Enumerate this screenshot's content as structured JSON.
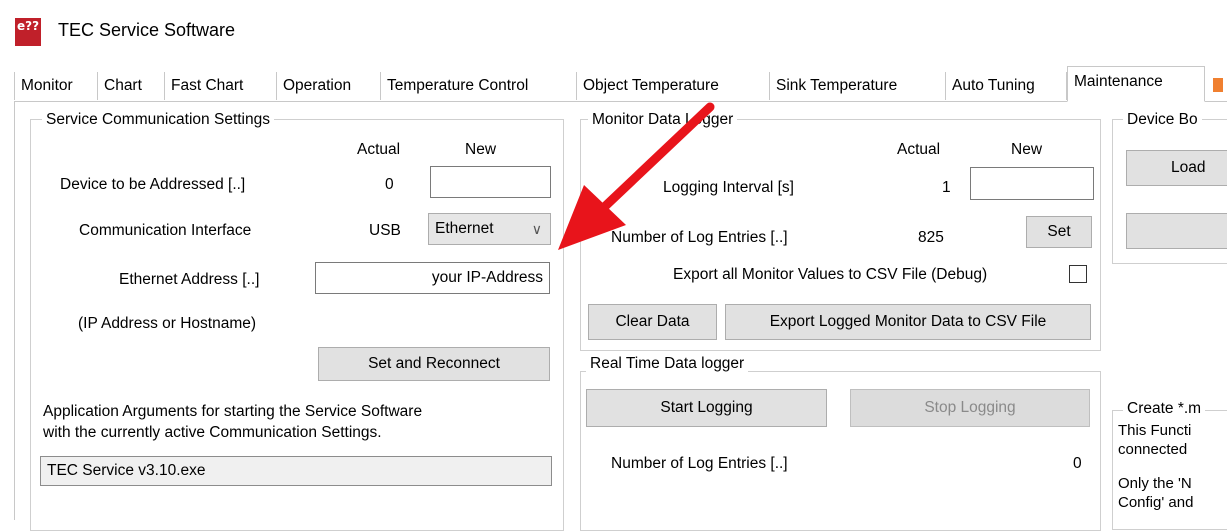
{
  "window": {
    "title": "TEC Service Software",
    "icon_text": "e??"
  },
  "tabs": [
    {
      "label": "Monitor"
    },
    {
      "label": "Chart"
    },
    {
      "label": "Fast Chart"
    },
    {
      "label": "Operation"
    },
    {
      "label": "Temperature Control"
    },
    {
      "label": "Object Temperature"
    },
    {
      "label": "Sink Temperature"
    },
    {
      "label": "Auto Tuning"
    },
    {
      "label": "Maintenance",
      "active": true
    }
  ],
  "service_comm": {
    "title": "Service Communication Settings",
    "col_actual": "Actual",
    "col_new": "New",
    "device_label": "Device to be Addressed [..]",
    "device_actual": "0",
    "device_new": "",
    "interface_label": "Communication Interface",
    "interface_actual": "USB",
    "interface_selected": "Ethernet",
    "ethernet_label": "Ethernet Address [..]",
    "ethernet_value": "your IP-Address",
    "ip_hint": "(IP Address or Hostname)",
    "reconnect_button": "Set and Reconnect",
    "app_args_line1": "Application Arguments for starting the Service Software",
    "app_args_line2": "with the currently active Communication Settings.",
    "app_args_value": "TEC Service v3.10.exe"
  },
  "monitor_logger": {
    "title": "Monitor Data Logger",
    "col_actual": "Actual",
    "col_new": "New",
    "interval_label": "Logging Interval [s]",
    "interval_actual": "1",
    "interval_new": "",
    "entries_label": "Number of Log Entries [..]",
    "entries_value": "825",
    "set_button": "Set",
    "export_all_label": "Export all Monitor Values to CSV File (Debug)",
    "export_all_checked": false,
    "clear_button": "Clear Data",
    "export_button": "Export Logged Monitor Data to CSV File"
  },
  "realtime_logger": {
    "title": "Real Time Data logger",
    "start_button": "Start Logging",
    "stop_button": "Stop Logging",
    "entries_label": "Number of Log Entries [..]",
    "entries_value": "0"
  },
  "device_boot": {
    "title": "Device Bo",
    "load_button": "Load"
  },
  "create_section": {
    "title": "Create *.m",
    "line1": "This Functi",
    "line2": "connected",
    "line3": "Only the 'N",
    "line4": "Config' and"
  },
  "annotation": {
    "arrow_color": "#e8141b"
  }
}
